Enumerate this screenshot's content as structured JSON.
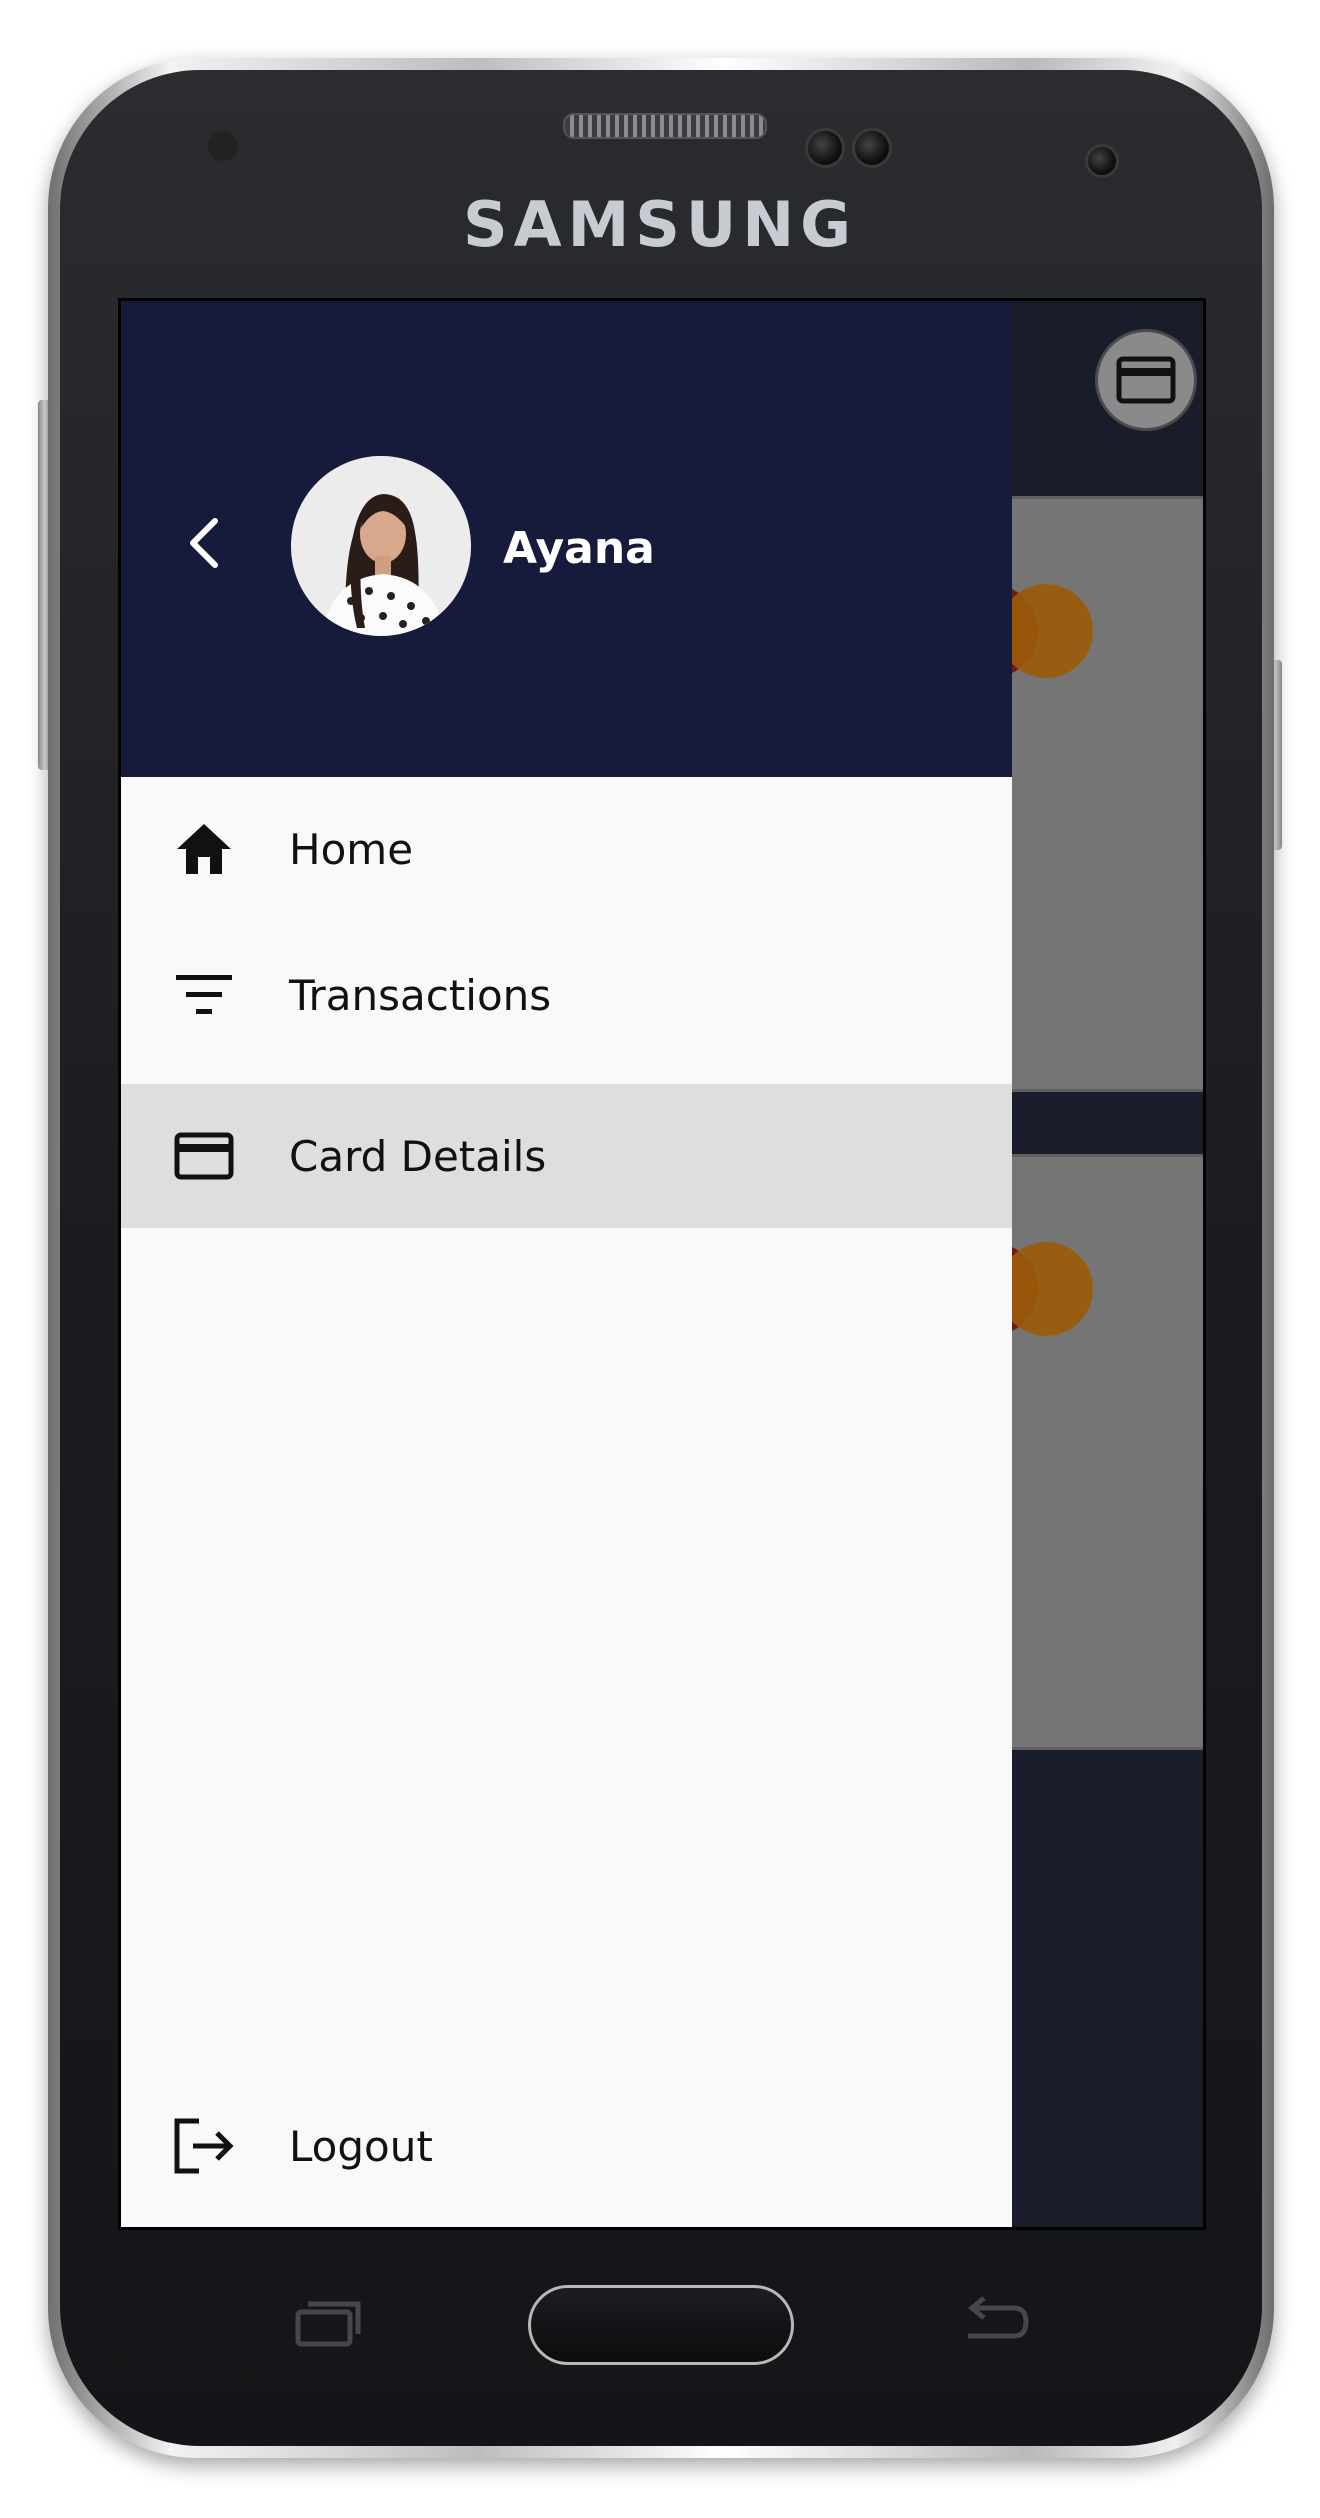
{
  "device": {
    "brand": "SAMSUNG"
  },
  "drawer": {
    "user_name": "Ayana",
    "menu": [
      {
        "label": "Home",
        "icon": "home-icon",
        "active": false
      },
      {
        "label": "Transactions",
        "icon": "filter-icon",
        "active": false
      },
      {
        "label": "Card Details",
        "icon": "credit-card-icon",
        "active": true
      }
    ],
    "logout_label": "Logout",
    "logout_icon": "logout-icon"
  },
  "colors": {
    "drawer_header": "#161b3b",
    "drawer_body": "#f9f9f9",
    "active_item": "#dedede",
    "app_background": "#191c2b"
  },
  "background_app": {
    "header_action_icon": "credit-card-icon",
    "cards": [
      {
        "logo": "mastercard-logo"
      },
      {
        "logo": "mastercard-logo"
      }
    ]
  }
}
